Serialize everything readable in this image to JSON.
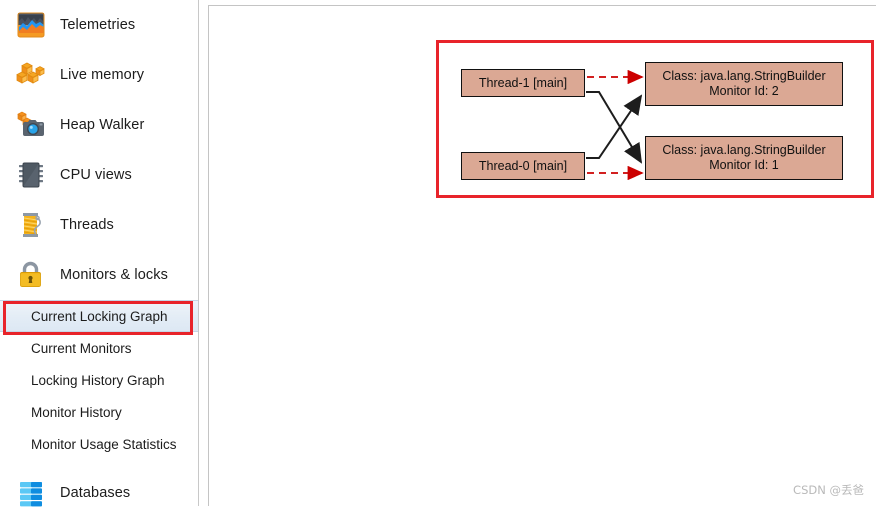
{
  "sidebar": {
    "major_items": [
      {
        "label": "Telemetries",
        "icon": "telemetries-chart-icon"
      },
      {
        "label": "Live memory",
        "icon": "live-memory-blocks-icon"
      },
      {
        "label": "Heap Walker",
        "icon": "heap-walker-camera-icon"
      },
      {
        "label": "CPU views",
        "icon": "cpu-chip-icon"
      },
      {
        "label": "Threads",
        "icon": "threads-spool-icon"
      },
      {
        "label": "Monitors & locks",
        "icon": "padlock-icon"
      }
    ],
    "sub_items": [
      {
        "label": "Current Locking Graph",
        "selected": true
      },
      {
        "label": "Current Monitors",
        "selected": false
      },
      {
        "label": "Locking History Graph",
        "selected": false
      },
      {
        "label": "Monitor History",
        "selected": false
      },
      {
        "label": "Monitor Usage Statistics",
        "selected": false
      }
    ],
    "footer_item": {
      "label": "Databases",
      "icon": "databases-stack-icon"
    },
    "highlight_color": "#e8232a",
    "selected_bg": "#e4edf6"
  },
  "graph": {
    "threads": [
      {
        "label": "Thread-1 [main]"
      },
      {
        "label": "Thread-0 [main]"
      }
    ],
    "monitors": [
      {
        "line1": "Class: java.lang.StringBuilder",
        "line2": "Monitor Id: 2"
      },
      {
        "line1": "Class: java.lang.StringBuilder",
        "line2": "Monitor Id: 1"
      }
    ],
    "edges": [
      {
        "from": "Thread-1 [main]",
        "to": "Monitor Id: 2",
        "style": "dashed",
        "color": "#cc0000",
        "meaning": "waiting-for"
      },
      {
        "from": "Thread-0 [main]",
        "to": "Monitor Id: 1",
        "style": "dashed",
        "color": "#cc0000",
        "meaning": "waiting-for"
      },
      {
        "from": "Thread-1 [main]",
        "to": "Monitor Id: 1",
        "style": "solid",
        "color": "#222222",
        "meaning": "owns"
      },
      {
        "from": "Thread-0 [main]",
        "to": "Monitor Id: 2",
        "style": "solid",
        "color": "#222222",
        "meaning": "owns"
      }
    ],
    "node_fill": "#dba894",
    "node_border": "#111111",
    "highlight_color": "#e8232a"
  },
  "watermark": {
    "text": "CSDN @丢爸"
  }
}
